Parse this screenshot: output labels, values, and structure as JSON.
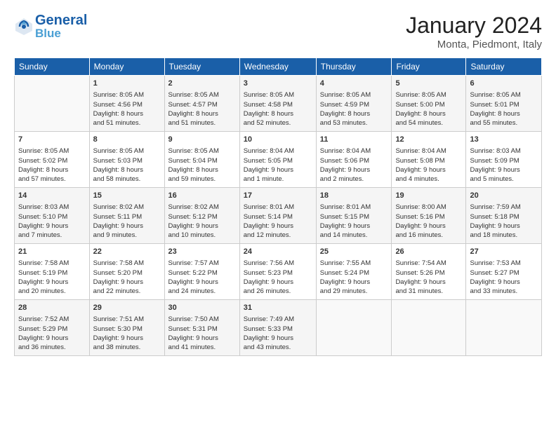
{
  "header": {
    "logo_line1": "General",
    "logo_line2": "Blue",
    "month_title": "January 2024",
    "subtitle": "Monta, Piedmont, Italy"
  },
  "days_of_week": [
    "Sunday",
    "Monday",
    "Tuesday",
    "Wednesday",
    "Thursday",
    "Friday",
    "Saturday"
  ],
  "weeks": [
    [
      {
        "num": "",
        "info": ""
      },
      {
        "num": "1",
        "info": "Sunrise: 8:05 AM\nSunset: 4:56 PM\nDaylight: 8 hours\nand 51 minutes."
      },
      {
        "num": "2",
        "info": "Sunrise: 8:05 AM\nSunset: 4:57 PM\nDaylight: 8 hours\nand 51 minutes."
      },
      {
        "num": "3",
        "info": "Sunrise: 8:05 AM\nSunset: 4:58 PM\nDaylight: 8 hours\nand 52 minutes."
      },
      {
        "num": "4",
        "info": "Sunrise: 8:05 AM\nSunset: 4:59 PM\nDaylight: 8 hours\nand 53 minutes."
      },
      {
        "num": "5",
        "info": "Sunrise: 8:05 AM\nSunset: 5:00 PM\nDaylight: 8 hours\nand 54 minutes."
      },
      {
        "num": "6",
        "info": "Sunrise: 8:05 AM\nSunset: 5:01 PM\nDaylight: 8 hours\nand 55 minutes."
      }
    ],
    [
      {
        "num": "7",
        "info": "Sunrise: 8:05 AM\nSunset: 5:02 PM\nDaylight: 8 hours\nand 57 minutes."
      },
      {
        "num": "8",
        "info": "Sunrise: 8:05 AM\nSunset: 5:03 PM\nDaylight: 8 hours\nand 58 minutes."
      },
      {
        "num": "9",
        "info": "Sunrise: 8:05 AM\nSunset: 5:04 PM\nDaylight: 8 hours\nand 59 minutes."
      },
      {
        "num": "10",
        "info": "Sunrise: 8:04 AM\nSunset: 5:05 PM\nDaylight: 9 hours\nand 1 minute."
      },
      {
        "num": "11",
        "info": "Sunrise: 8:04 AM\nSunset: 5:06 PM\nDaylight: 9 hours\nand 2 minutes."
      },
      {
        "num": "12",
        "info": "Sunrise: 8:04 AM\nSunset: 5:08 PM\nDaylight: 9 hours\nand 4 minutes."
      },
      {
        "num": "13",
        "info": "Sunrise: 8:03 AM\nSunset: 5:09 PM\nDaylight: 9 hours\nand 5 minutes."
      }
    ],
    [
      {
        "num": "14",
        "info": "Sunrise: 8:03 AM\nSunset: 5:10 PM\nDaylight: 9 hours\nand 7 minutes."
      },
      {
        "num": "15",
        "info": "Sunrise: 8:02 AM\nSunset: 5:11 PM\nDaylight: 9 hours\nand 9 minutes."
      },
      {
        "num": "16",
        "info": "Sunrise: 8:02 AM\nSunset: 5:12 PM\nDaylight: 9 hours\nand 10 minutes."
      },
      {
        "num": "17",
        "info": "Sunrise: 8:01 AM\nSunset: 5:14 PM\nDaylight: 9 hours\nand 12 minutes."
      },
      {
        "num": "18",
        "info": "Sunrise: 8:01 AM\nSunset: 5:15 PM\nDaylight: 9 hours\nand 14 minutes."
      },
      {
        "num": "19",
        "info": "Sunrise: 8:00 AM\nSunset: 5:16 PM\nDaylight: 9 hours\nand 16 minutes."
      },
      {
        "num": "20",
        "info": "Sunrise: 7:59 AM\nSunset: 5:18 PM\nDaylight: 9 hours\nand 18 minutes."
      }
    ],
    [
      {
        "num": "21",
        "info": "Sunrise: 7:58 AM\nSunset: 5:19 PM\nDaylight: 9 hours\nand 20 minutes."
      },
      {
        "num": "22",
        "info": "Sunrise: 7:58 AM\nSunset: 5:20 PM\nDaylight: 9 hours\nand 22 minutes."
      },
      {
        "num": "23",
        "info": "Sunrise: 7:57 AM\nSunset: 5:22 PM\nDaylight: 9 hours\nand 24 minutes."
      },
      {
        "num": "24",
        "info": "Sunrise: 7:56 AM\nSunset: 5:23 PM\nDaylight: 9 hours\nand 26 minutes."
      },
      {
        "num": "25",
        "info": "Sunrise: 7:55 AM\nSunset: 5:24 PM\nDaylight: 9 hours\nand 29 minutes."
      },
      {
        "num": "26",
        "info": "Sunrise: 7:54 AM\nSunset: 5:26 PM\nDaylight: 9 hours\nand 31 minutes."
      },
      {
        "num": "27",
        "info": "Sunrise: 7:53 AM\nSunset: 5:27 PM\nDaylight: 9 hours\nand 33 minutes."
      }
    ],
    [
      {
        "num": "28",
        "info": "Sunrise: 7:52 AM\nSunset: 5:29 PM\nDaylight: 9 hours\nand 36 minutes."
      },
      {
        "num": "29",
        "info": "Sunrise: 7:51 AM\nSunset: 5:30 PM\nDaylight: 9 hours\nand 38 minutes."
      },
      {
        "num": "30",
        "info": "Sunrise: 7:50 AM\nSunset: 5:31 PM\nDaylight: 9 hours\nand 41 minutes."
      },
      {
        "num": "31",
        "info": "Sunrise: 7:49 AM\nSunset: 5:33 PM\nDaylight: 9 hours\nand 43 minutes."
      },
      {
        "num": "",
        "info": ""
      },
      {
        "num": "",
        "info": ""
      },
      {
        "num": "",
        "info": ""
      }
    ]
  ]
}
